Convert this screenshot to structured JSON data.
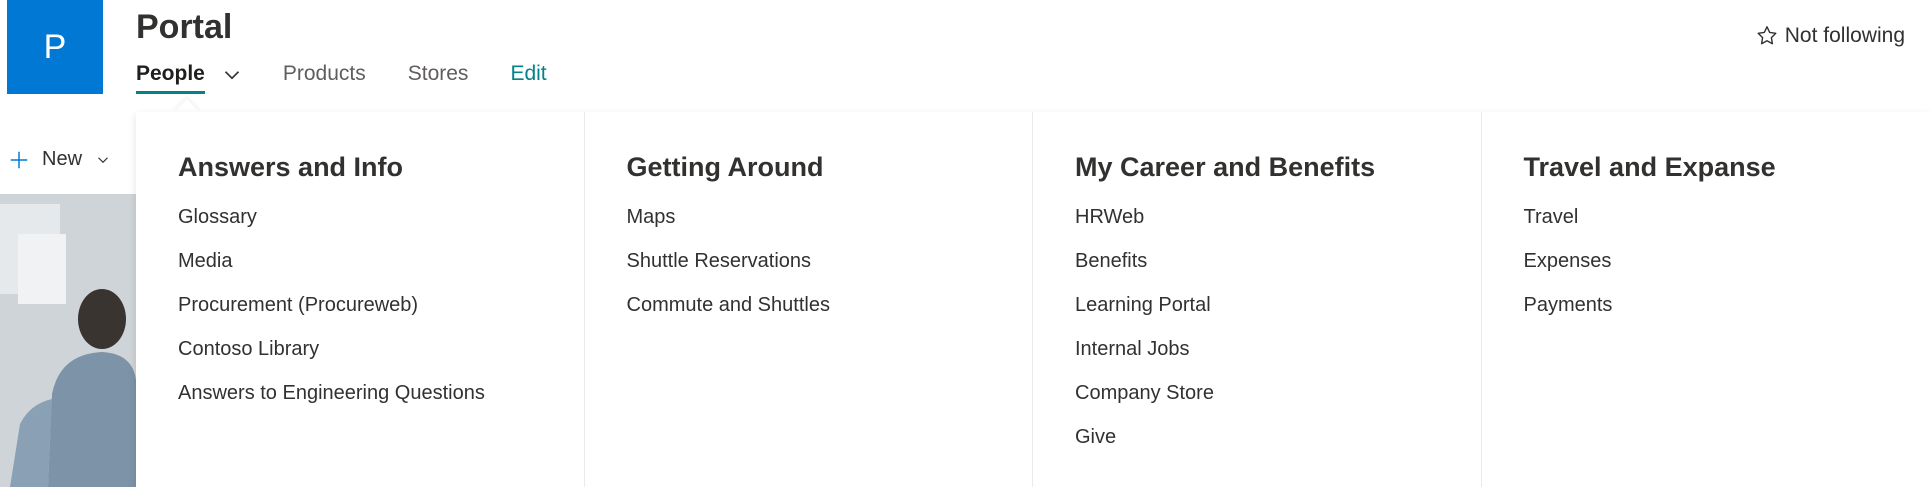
{
  "site": {
    "logo_letter": "P",
    "title": "Portal",
    "follow_label": "Not following"
  },
  "nav": {
    "items": [
      {
        "label": "People"
      },
      {
        "label": "Products"
      },
      {
        "label": "Stores"
      },
      {
        "label": "Edit"
      }
    ]
  },
  "command_bar": {
    "new_label": "New"
  },
  "mega_menu": {
    "columns": [
      {
        "heading": "Answers and Info",
        "links": [
          "Glossary",
          "Media",
          "Procurement (Procureweb)",
          "Contoso Library",
          "Answers to Engineering Questions"
        ]
      },
      {
        "heading": "Getting Around",
        "links": [
          "Maps",
          "Shuttle Reservations",
          "Commute and Shuttles"
        ]
      },
      {
        "heading": "My Career and Benefits",
        "links": [
          "HRWeb",
          "Benefits",
          "Learning Portal",
          "Internal Jobs",
          "Company Store",
          "Give"
        ]
      },
      {
        "heading": "Travel and Expanse",
        "links": [
          "Travel",
          "Expenses",
          "Payments"
        ]
      }
    ]
  },
  "colors": {
    "logo_bg": "#0078d4",
    "accent": "#038387"
  }
}
